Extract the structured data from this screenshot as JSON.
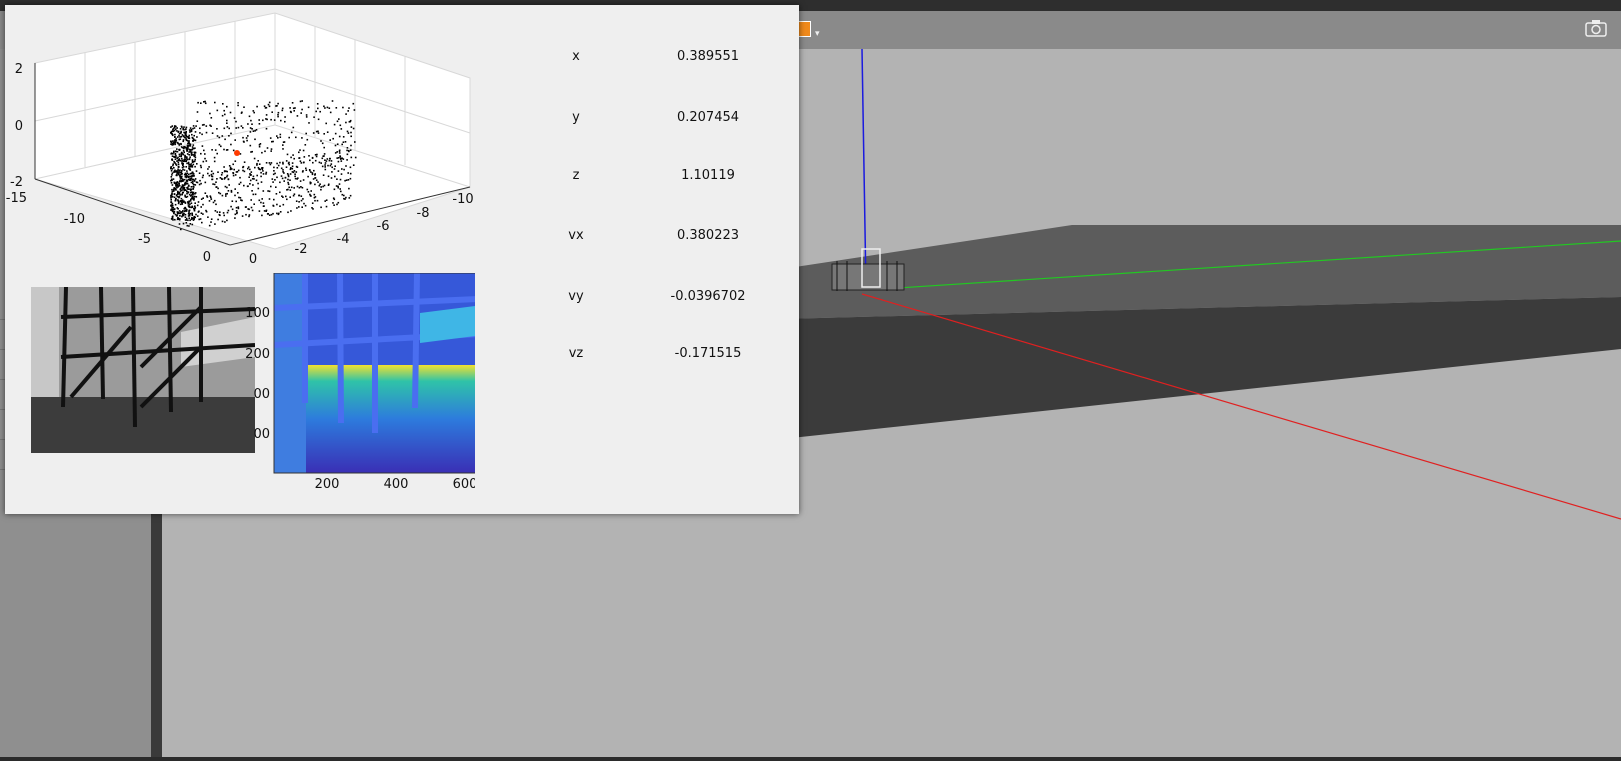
{
  "simulator": {
    "toolbar_icons": [
      "orange-box-icon",
      "camera-icon"
    ],
    "colors": {
      "x_axis": "#e02020",
      "y_axis": "#22c822",
      "z_axis": "#1a1ae0",
      "ground": "#3a3a3a"
    }
  },
  "figure": {
    "readouts": [
      {
        "label": "x",
        "value": "0.389551"
      },
      {
        "label": "y",
        "value": "0.207454"
      },
      {
        "label": "z",
        "value": "1.10119"
      },
      {
        "label": "vx",
        "value": "0.380223"
      },
      {
        "label": "vy",
        "value": "-0.0396702"
      },
      {
        "label": "vz",
        "value": "-0.171515"
      }
    ],
    "pointcloud_axes": {
      "z_ticks": [
        "2",
        "0",
        "-2"
      ],
      "x_ticks": [
        "-15",
        "-10",
        "-5",
        "0"
      ],
      "y_ticks": [
        "0",
        "-2",
        "-4",
        "-6",
        "-8",
        "-10"
      ]
    },
    "depth_axes": {
      "x_ticks": [
        "200",
        "400",
        "600"
      ],
      "y_ticks": [
        "100",
        "200",
        "00",
        "00"
      ]
    }
  }
}
